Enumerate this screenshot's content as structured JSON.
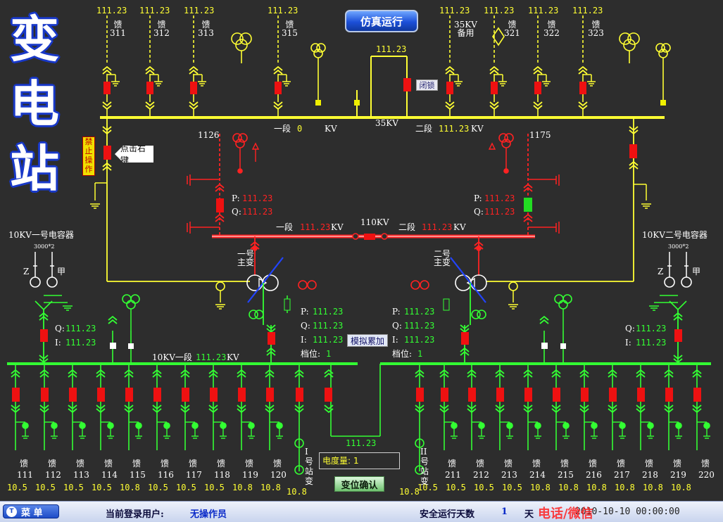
{
  "title": {
    "chars": [
      "变",
      "电",
      "站"
    ]
  },
  "buttons": {
    "simulate": "仿真运行",
    "lock": "闭锁",
    "forbid": "禁止操作",
    "right_click": "点击右键",
    "sim_accumulate": "模拟累加",
    "confirm": "变位确认"
  },
  "top": {
    "feeder_values": [
      "111.23",
      "111.23",
      "111.23",
      "111.23",
      "111.23",
      "111.23",
      "111.23",
      "111.23"
    ],
    "left_feeders": [
      {
        "line1": "馈",
        "line2": "311"
      },
      {
        "line1": "馈",
        "line2": "312"
      },
      {
        "line1": "馈",
        "line2": "313"
      },
      {
        "line1": "馈",
        "line2": "315"
      }
    ],
    "right_feeders": [
      {
        "line1": "35KV",
        "line2": "备用"
      },
      {
        "line1": "馈",
        "line2": "321"
      },
      {
        "line1": "馈",
        "line2": "322"
      },
      {
        "line1": "馈",
        "line2": "323"
      }
    ],
    "bridge_value": "111.23",
    "sec1_label": "一段",
    "sec1_value": "0",
    "kv": "KV",
    "bus_label": "35KV",
    "sec2_label": "二段",
    "sec2_value": "111.23",
    "kv2": "KV",
    "id_left": "1126",
    "id_right": "1175"
  },
  "middle": {
    "p_label": "P:",
    "q_label": "Q:",
    "p_left": "111.23",
    "q_left": "111.23",
    "p_right": "111.23",
    "q_right": "111.23",
    "bus110_label": "110KV",
    "sec1": "一段",
    "sec1_val": "111.23",
    "sec2": "二段",
    "sec2_val": "111.23",
    "kv": "KV",
    "tx1_line1": "一号",
    "tx1_line2": "主变",
    "tx2_line1": "二号",
    "tx2_line2": "主变"
  },
  "capacitors": {
    "left_title": "10KV一号电容器",
    "right_title": "10KV二号电容器",
    "rating": "3000*2",
    "z_label": "Z",
    "j_label": "甲",
    "q_label": "Q:",
    "i_label": "I:",
    "left_q": "111.23",
    "left_i": "111.23",
    "right_q": "111.23",
    "right_i": "111.23"
  },
  "tx_readings": {
    "labels": {
      "p": "P:",
      "q": "Q:",
      "i": "I:",
      "tap": "档位:"
    },
    "left": {
      "p": "111.23",
      "q": "111.23",
      "i": "111.23",
      "tap": "1"
    },
    "right": {
      "p": "111.23",
      "q": "111.23",
      "i": "111.23",
      "tap": "1"
    }
  },
  "bus10": {
    "label": "10KV一段",
    "value": "111.23",
    "kv": "KV",
    "bridge_value": "111.23"
  },
  "feeders_bottom": {
    "left": [
      {
        "name": "馈",
        "id": "111",
        "v": "10.5"
      },
      {
        "name": "馈",
        "id": "112",
        "v": "10.5"
      },
      {
        "name": "馈",
        "id": "113",
        "v": "10.5"
      },
      {
        "name": "馈",
        "id": "114",
        "v": "10.5"
      },
      {
        "name": "馈",
        "id": "115",
        "v": "10.8"
      },
      {
        "name": "馈",
        "id": "116",
        "v": "10.5"
      },
      {
        "name": "馈",
        "id": "117",
        "v": "10.5"
      },
      {
        "name": "馈",
        "id": "118",
        "v": "10.5"
      },
      {
        "name": "馈",
        "id": "119",
        "v": "10.8"
      },
      {
        "name": "馈",
        "id": "120",
        "v": "10.8"
      }
    ],
    "right": [
      {
        "name": "馈",
        "id": "211",
        "v": "10.5"
      },
      {
        "name": "馈",
        "id": "212",
        "v": "10.5"
      },
      {
        "name": "馈",
        "id": "213",
        "v": "10.5"
      },
      {
        "name": "馈",
        "id": "214",
        "v": "10.5"
      },
      {
        "name": "馈",
        "id": "215",
        "v": "10.8"
      },
      {
        "name": "馈",
        "id": "216",
        "v": "10.8"
      },
      {
        "name": "馈",
        "id": "217",
        "v": "10.8"
      },
      {
        "name": "馈",
        "id": "218",
        "v": "10.8"
      },
      {
        "name": "馈",
        "id": "219",
        "v": "10.8"
      },
      {
        "name": "馈",
        "id": "220",
        "v": "10.8"
      }
    ],
    "station1": {
      "chars": [
        "I",
        "号",
        "站",
        "变"
      ],
      "v": "10.8"
    },
    "station2": {
      "chars": [
        "II",
        "号",
        "站",
        "变"
      ],
      "v": "10.8"
    }
  },
  "meter": {
    "label": "电度量:",
    "value": "1"
  },
  "status": {
    "menu": "菜 单",
    "user_label": "当前登录用户:",
    "user_value": "无操作员",
    "days_label": "安全运行天数",
    "days_value": "1",
    "days_unit": "天",
    "datetime": "2010-10-10   00:00:00",
    "watermark": "电话/微信"
  },
  "colors": {
    "bus35": "#ffff33",
    "bus110": "#ff2222",
    "bus10": "#33ff33",
    "breaker_red": "#ee1111",
    "breaker_green": "#22dd22"
  }
}
